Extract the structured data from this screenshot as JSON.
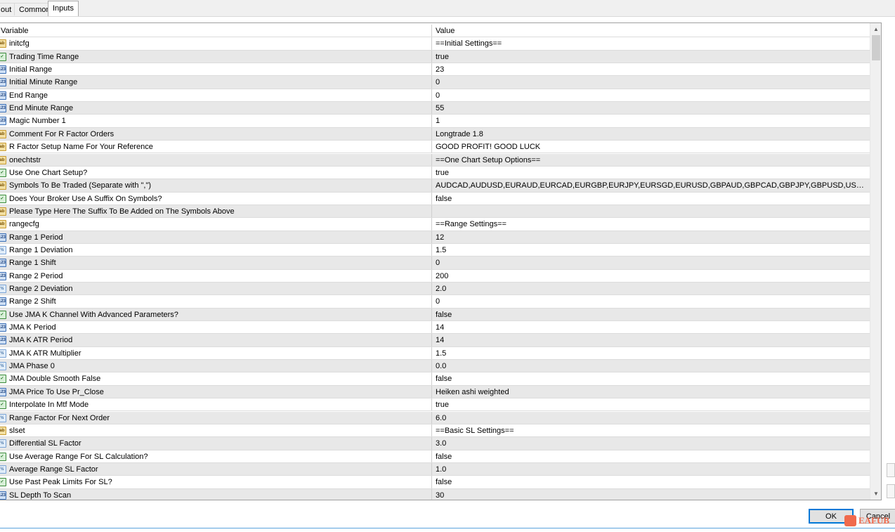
{
  "tabs": [
    {
      "label": "out",
      "active": false
    },
    {
      "label": "Common",
      "active": false
    },
    {
      "label": "Inputs",
      "active": true
    }
  ],
  "grid": {
    "header": {
      "variable": "Variable",
      "value": "Value"
    },
    "rows": [
      {
        "type": "str",
        "variable": "initcfg",
        "value": "==Initial Settings=="
      },
      {
        "type": "bool",
        "variable": "Trading Time Range",
        "value": "true"
      },
      {
        "type": "int",
        "variable": "Initial Range",
        "value": "23"
      },
      {
        "type": "int",
        "variable": "Initial Minute Range",
        "value": "0"
      },
      {
        "type": "int",
        "variable": "End Range",
        "value": "0"
      },
      {
        "type": "int",
        "variable": "End Minute Range",
        "value": "55"
      },
      {
        "type": "int",
        "variable": "Magic Number 1",
        "value": "1"
      },
      {
        "type": "str",
        "variable": "Comment For R Factor Orders",
        "value": "Longtrade 1.8"
      },
      {
        "type": "str",
        "variable": "R Factor Setup Name For Your Reference",
        "value": "GOOD PROFIT! GOOD LUCK"
      },
      {
        "type": "str",
        "variable": "onechtstr",
        "value": "==One Chart Setup Options=="
      },
      {
        "type": "bool",
        "variable": "Use One Chart Setup?",
        "value": "true"
      },
      {
        "type": "str",
        "variable": "Symbols To Be Traded (Separate with \",\")",
        "value": "AUDCAD,AUDUSD,EURAUD,EURCAD,EURGBP,EURJPY,EURSGD,EURUSD,GBPAUD,GBPCAD,GBPJPY,GBPUSD,USDCAD,USDJPY,US..."
      },
      {
        "type": "bool",
        "variable": "Does Your Broker Use A Suffix On Symbols?",
        "value": "false"
      },
      {
        "type": "str",
        "variable": "Please Type Here The Suffix To Be Added on The Symbols Above",
        "value": ""
      },
      {
        "type": "str",
        "variable": "rangecfg",
        "value": "==Range Settings=="
      },
      {
        "type": "int",
        "variable": "Range 1 Period",
        "value": "12"
      },
      {
        "type": "dbl",
        "variable": "Range 1 Deviation",
        "value": "1.5"
      },
      {
        "type": "int",
        "variable": "Range 1 Shift",
        "value": "0"
      },
      {
        "type": "int",
        "variable": "Range 2 Period",
        "value": "200"
      },
      {
        "type": "dbl",
        "variable": "Range 2 Deviation",
        "value": "2.0"
      },
      {
        "type": "int",
        "variable": "Range 2 Shift",
        "value": "0"
      },
      {
        "type": "bool",
        "variable": "Use JMA K Channel With Advanced Parameters?",
        "value": "false"
      },
      {
        "type": "int",
        "variable": "JMA K Period",
        "value": "14"
      },
      {
        "type": "int",
        "variable": "JMA K ATR Period",
        "value": "14"
      },
      {
        "type": "dbl",
        "variable": "JMA K ATR Multiplier",
        "value": "1.5"
      },
      {
        "type": "dbl",
        "variable": "JMA Phase 0",
        "value": "0.0"
      },
      {
        "type": "bool",
        "variable": "JMA Double Smooth False",
        "value": "false"
      },
      {
        "type": "int",
        "variable": "JMA Price To Use Pr_Close",
        "value": "Heiken ashi weighted"
      },
      {
        "type": "bool",
        "variable": "Interpolate In Mtf Mode",
        "value": "true"
      },
      {
        "type": "dbl",
        "variable": "Range Factor For Next Order",
        "value": "6.0"
      },
      {
        "type": "str",
        "variable": "slset",
        "value": "==Basic SL Settings=="
      },
      {
        "type": "dbl",
        "variable": "Differential SL Factor",
        "value": "3.0"
      },
      {
        "type": "bool",
        "variable": "Use Average Range For SL Calculation?",
        "value": "false"
      },
      {
        "type": "dbl",
        "variable": "Average Range SL Factor",
        "value": "1.0"
      },
      {
        "type": "bool",
        "variable": "Use Past Peak Limits For SL?",
        "value": "false"
      },
      {
        "type": "int",
        "variable": "SL Depth To Scan",
        "value": "30"
      }
    ]
  },
  "icon_glyphs": {
    "str": "ab",
    "bool": "✓",
    "int": "123",
    "dbl": "½"
  },
  "buttons": {
    "ok": "OK",
    "cancel": "Cancel"
  },
  "watermark": {
    "text": "EAFUB"
  },
  "colors": {
    "accent": "#0078d7",
    "row_alt": "#e8e8e8",
    "watermark": "#f06a4d"
  }
}
